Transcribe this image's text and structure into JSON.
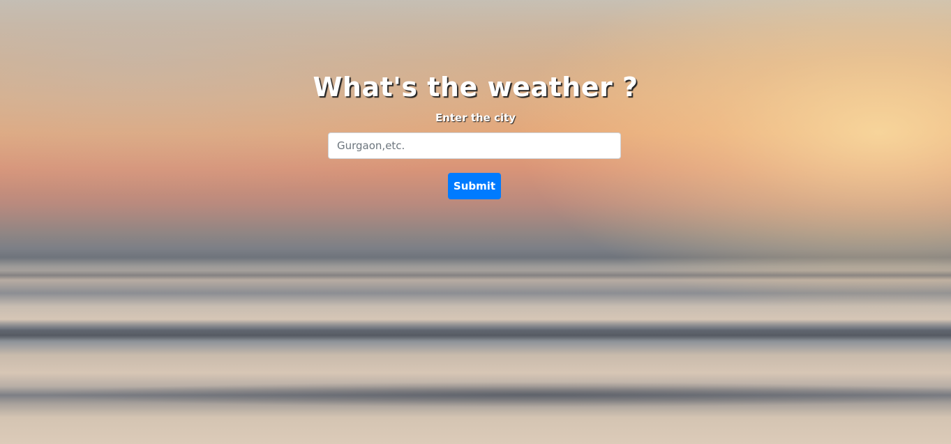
{
  "page": {
    "heading": "What's the weather ?",
    "city_label": "Enter the city"
  },
  "search": {
    "value": "",
    "placeholder": "Gurgaon,etc."
  },
  "form": {
    "submit_label": "Submit"
  },
  "colors": {
    "button": "#007bff",
    "heading_text": "#ffffff"
  }
}
